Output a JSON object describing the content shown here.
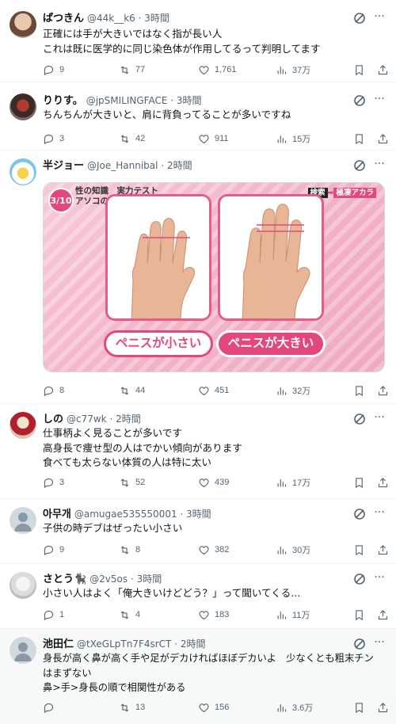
{
  "tweets": [
    {
      "name": "ぱつきん",
      "handle": "@44k__k6",
      "time": "3時間",
      "lines": [
        "正確には手が大きいではなく指が長い人",
        "これは既に医学的に同じ染色体が作用してるって判明してます"
      ],
      "replies": "9",
      "retweets": "77",
      "likes": "1,761",
      "views": "37万"
    },
    {
      "name": "りりす。",
      "handle": "@jpSMILINGFACE",
      "time": "3時間",
      "lines": [
        "ちんちんが大きいと、肩に背負ってることが多いですね"
      ],
      "replies": "3",
      "retweets": "42",
      "likes": "911",
      "views": "15万"
    },
    {
      "name": "半ジョー",
      "handle": "@Joe_Hannibal",
      "time": "2時間",
      "lines": [],
      "media": {
        "badge": "3/10",
        "heading_line1": "性の知識　実力テスト",
        "heading_line2": "アソコの大きさを見破る方法",
        "tag_left": "検索",
        "tag_arrow": "➡",
        "tag_right": "極凄アカラ",
        "label_small": "ペニスが小さい",
        "label_big": "ペニスが大きい"
      },
      "replies": "8",
      "retweets": "44",
      "likes": "451",
      "views": "32万"
    },
    {
      "name": "しの",
      "handle": "@c77wk",
      "time": "2時間",
      "lines": [
        "仕事柄よく見ることが多いです",
        "高身長で痩せ型の人はでかい傾向があります",
        "食べても太らない体質の人は特に太い"
      ],
      "replies": "3",
      "retweets": "52",
      "likes": "439",
      "views": "17万"
    },
    {
      "name": "아무개",
      "handle": "@amugae535550001",
      "time": "3時間",
      "lines": [
        "子供の時デブはぜったい小さい"
      ],
      "replies": "9",
      "retweets": "8",
      "likes": "382",
      "views": "30万"
    },
    {
      "name": "さとう🐈‍⬛",
      "handle": "@2v5os",
      "time": "3時間",
      "lines": [
        "小さい人はよく「俺大きいけどどう？」って聞いてくる..."
      ],
      "replies": "1",
      "retweets": "4",
      "likes": "183",
      "views": "11万"
    },
    {
      "name": "池田仁",
      "handle": "@tXeGLpTn7F4srCT",
      "time": "2時間",
      "lines": [
        "身長が高く鼻が高く手や足がデカければほぼデカいよ　少なくとも粗末チン",
        "はまずない",
        "鼻>手>身長の順で相関性がある"
      ],
      "replies": "",
      "retweets": "13",
      "likes": "156",
      "views": "3.6万"
    }
  ],
  "icons": {
    "reply": "reply-icon",
    "retweet": "retweet-icon",
    "like": "heart-icon",
    "views": "views-icon",
    "bookmark": "bookmark-icon",
    "share": "share-icon",
    "grok": "grok-icon",
    "more": "more-icon"
  },
  "colors": {
    "text": "#0f1419",
    "muted": "#536471",
    "divider": "#eff3f4",
    "pink": "#e4487a"
  }
}
